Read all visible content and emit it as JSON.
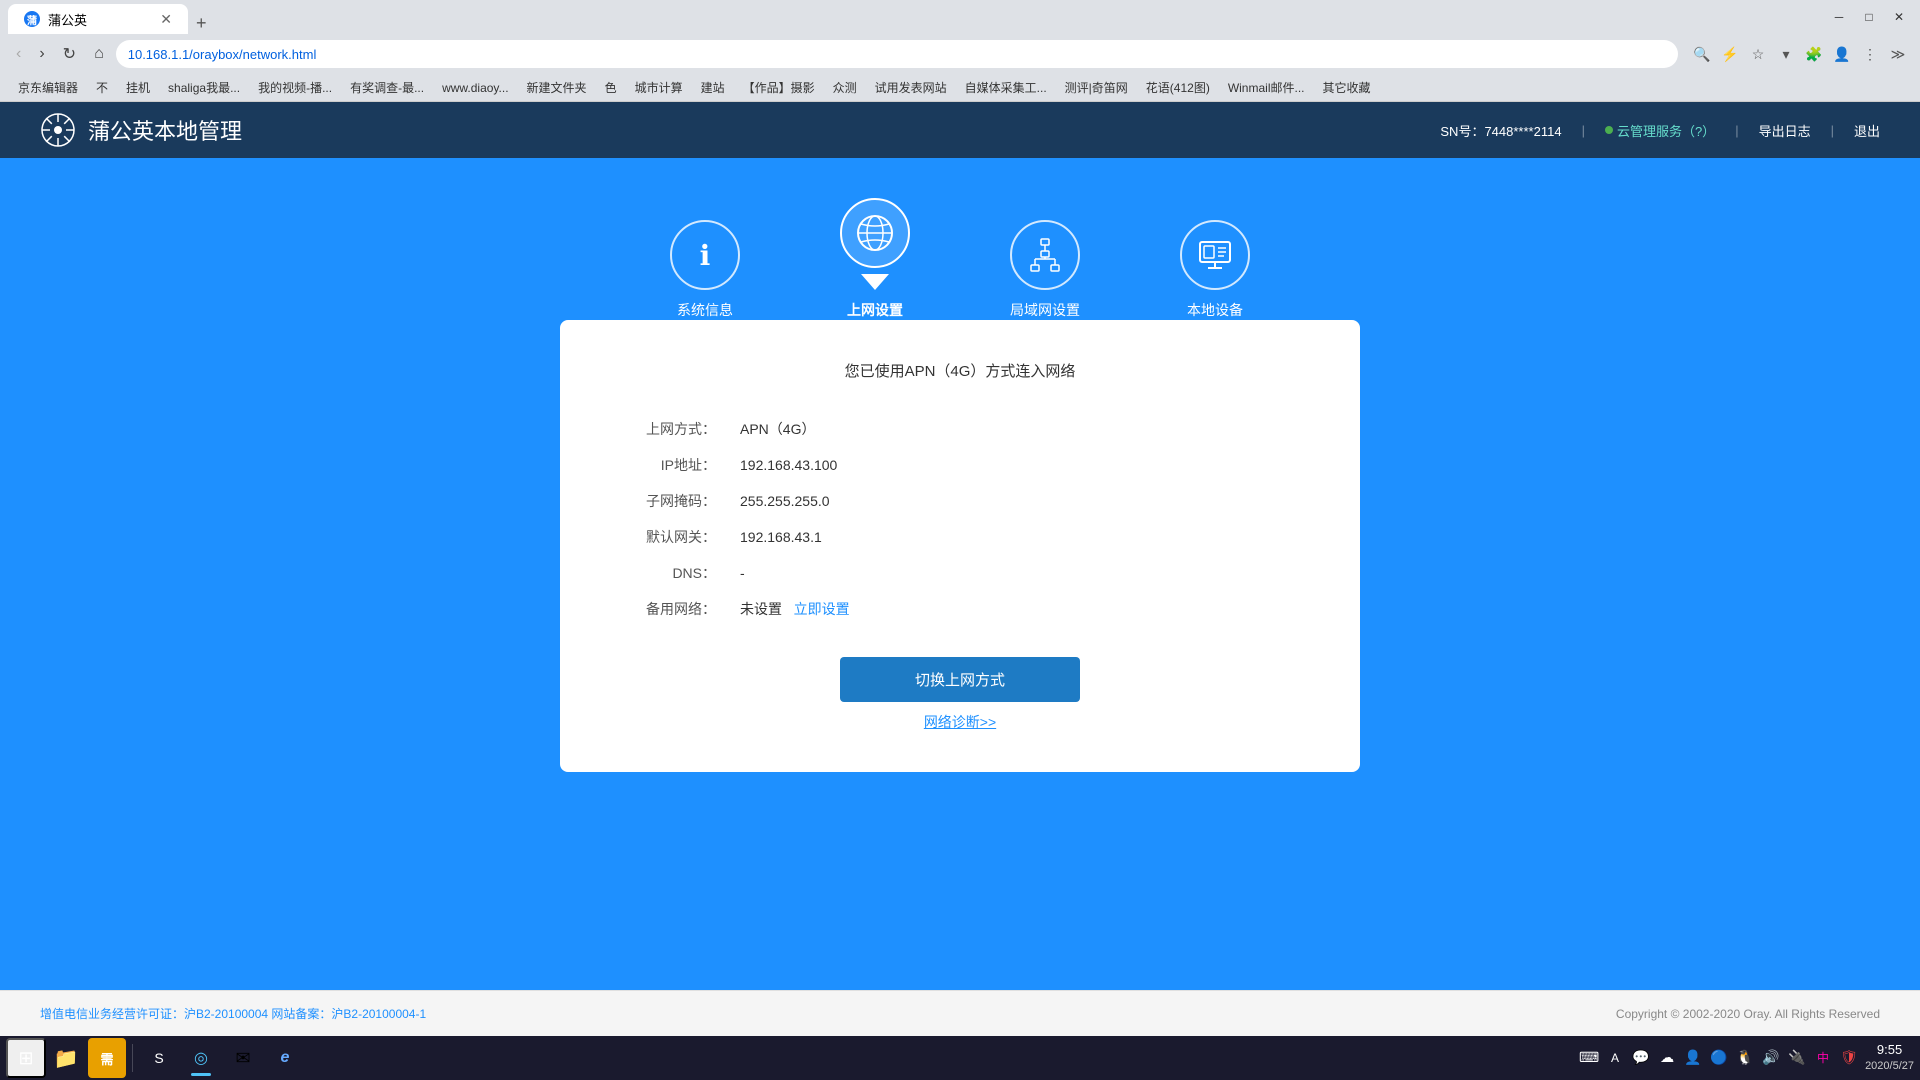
{
  "browser": {
    "tab_title": "蒲公英",
    "tab_favicon": "蒲",
    "url": "10.168.1.1/oraybox/network.html",
    "new_tab_label": "+",
    "bookmarks": [
      {
        "label": "京东编辑器"
      },
      {
        "label": "不"
      },
      {
        "label": "挂机"
      },
      {
        "label": "shaliga我最..."
      },
      {
        "label": "我的视频-播..."
      },
      {
        "label": "有奖调查-最..."
      },
      {
        "label": "www.diaoy..."
      },
      {
        "label": "新建文件夹"
      },
      {
        "label": "色"
      },
      {
        "label": "城市计算"
      },
      {
        "label": "建站"
      },
      {
        "label": "【作品】摄影"
      },
      {
        "label": "众测"
      },
      {
        "label": "试用发表网站"
      },
      {
        "label": "自媒体采集工..."
      },
      {
        "label": "测评|奇笛网"
      },
      {
        "label": "花语(412图)"
      },
      {
        "label": "Winmail邮件..."
      },
      {
        "label": "其它收藏"
      }
    ]
  },
  "app": {
    "logo_text": "蒲公英本地管理",
    "sn_label": "SN号：7448****2114",
    "cloud_service_label": "云管理服务（?）",
    "export_log_label": "导出日志",
    "logout_label": "退出"
  },
  "nav": {
    "items": [
      {
        "id": "sysinfo",
        "label": "系统信息",
        "icon": "ℹ",
        "active": false
      },
      {
        "id": "network",
        "label": "上网设置",
        "icon": "🌐",
        "active": true
      },
      {
        "id": "lan",
        "label": "局域网设置",
        "icon": "⊙",
        "active": false
      },
      {
        "id": "devices",
        "label": "本地设备",
        "icon": "🖥",
        "active": false
      }
    ]
  },
  "panel": {
    "title": "您已使用APN（4G）方式连入网络",
    "fields": [
      {
        "label": "上网方式：",
        "value": "APN（4G）"
      },
      {
        "label": "IP地址：",
        "value": "192.168.43.100"
      },
      {
        "label": "子网掩码：",
        "value": "255.255.255.0"
      },
      {
        "label": "默认网关：",
        "value": "192.168.43.1"
      },
      {
        "label": "DNS：",
        "value": "-"
      },
      {
        "label": "备用网络：",
        "value": "未设置",
        "link": "立即设置",
        "link_href": "#"
      }
    ],
    "switch_btn": "切换上网方式",
    "diagnose_link": "网络诊断>>"
  },
  "footer": {
    "icp_text": "增值电信业务经营许可证：沪B2-20100004 网站备案：沪B2-20100004-1",
    "copyright": "Copyright © 2002-2020 Oray. All Rights Reserved"
  },
  "taskbar": {
    "time": "9:55",
    "date": "2020/5/27",
    "start_icon": "⊞",
    "apps": [
      {
        "name": "file-explorer",
        "icon": "📁",
        "active": false
      },
      {
        "name": "needs-app",
        "icon": "需",
        "active": false
      },
      {
        "name": "input-ime",
        "icon": "S",
        "active": false
      },
      {
        "name": "browser-1",
        "icon": "◎",
        "active": true
      },
      {
        "name": "app2",
        "icon": "✉",
        "active": false
      },
      {
        "name": "edge",
        "icon": "e",
        "active": false
      }
    ]
  }
}
